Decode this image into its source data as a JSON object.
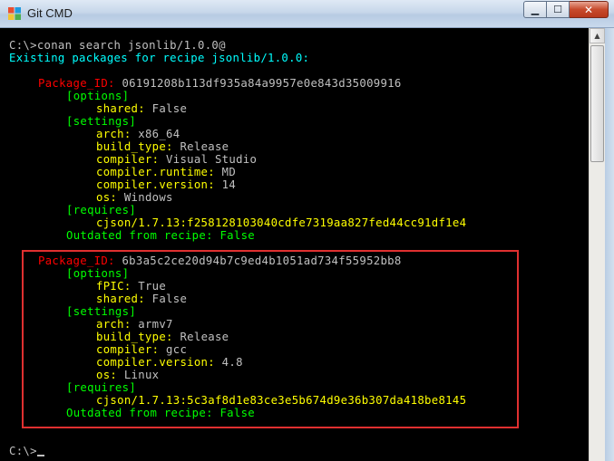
{
  "window": {
    "title": "Git CMD",
    "minimize_label": "▁",
    "maximize_label": "☐",
    "close_label": "✕"
  },
  "terminal": {
    "line01": {
      "prompt": "C:\\>conan search jsonlib/1.0.0@"
    },
    "line02": {
      "text": "Existing packages for recipe jsonlib/1.0.0:"
    },
    "pkg1": {
      "id_label": "Package_ID:",
      "id_value": " 06191208b113df935a84a9957e0e843d35009916",
      "options_header": "[options]",
      "shared_key": "shared:",
      "shared_val": " False",
      "settings_header": "[settings]",
      "arch_key": "arch:",
      "arch_val": " x86_64",
      "build_type_key": "build_type:",
      "build_type_val": " Release",
      "compiler_key": "compiler:",
      "compiler_val": " Visual Studio",
      "runtime_key": "compiler.runtime:",
      "runtime_val": " MD",
      "version_key": "compiler.version:",
      "version_val": " 14",
      "os_key": "os:",
      "os_val": " Windows",
      "requires_header": "[requires]",
      "requires_val": "cjson/1.7.13:f258128103040cdfe7319aa827fed44cc91df1e4",
      "outdated": "Outdated from recipe: False"
    },
    "pkg2": {
      "id_label": "Package_ID:",
      "id_value": " 6b3a5c2ce20d94b7c9ed4b1051ad734f55952bb8",
      "options_header": "[options]",
      "fpic_key": "fPIC:",
      "fpic_val": " True",
      "shared_key": "shared:",
      "shared_val": " False",
      "settings_header": "[settings]",
      "arch_key": "arch:",
      "arch_val": " armv7",
      "build_type_key": "build_type:",
      "build_type_val": " Release",
      "compiler_key": "compiler:",
      "compiler_val": " gcc",
      "version_key": "compiler.version:",
      "version_val": " 4.8",
      "os_key": "os:",
      "os_val": " Linux",
      "requires_header": "[requires]",
      "requires_val": "cjson/1.7.13:5c3af8d1e83ce3e5b674d9e36b307da418be8145",
      "outdated": "Outdated from recipe: False"
    },
    "final_prompt": "C:\\>"
  }
}
